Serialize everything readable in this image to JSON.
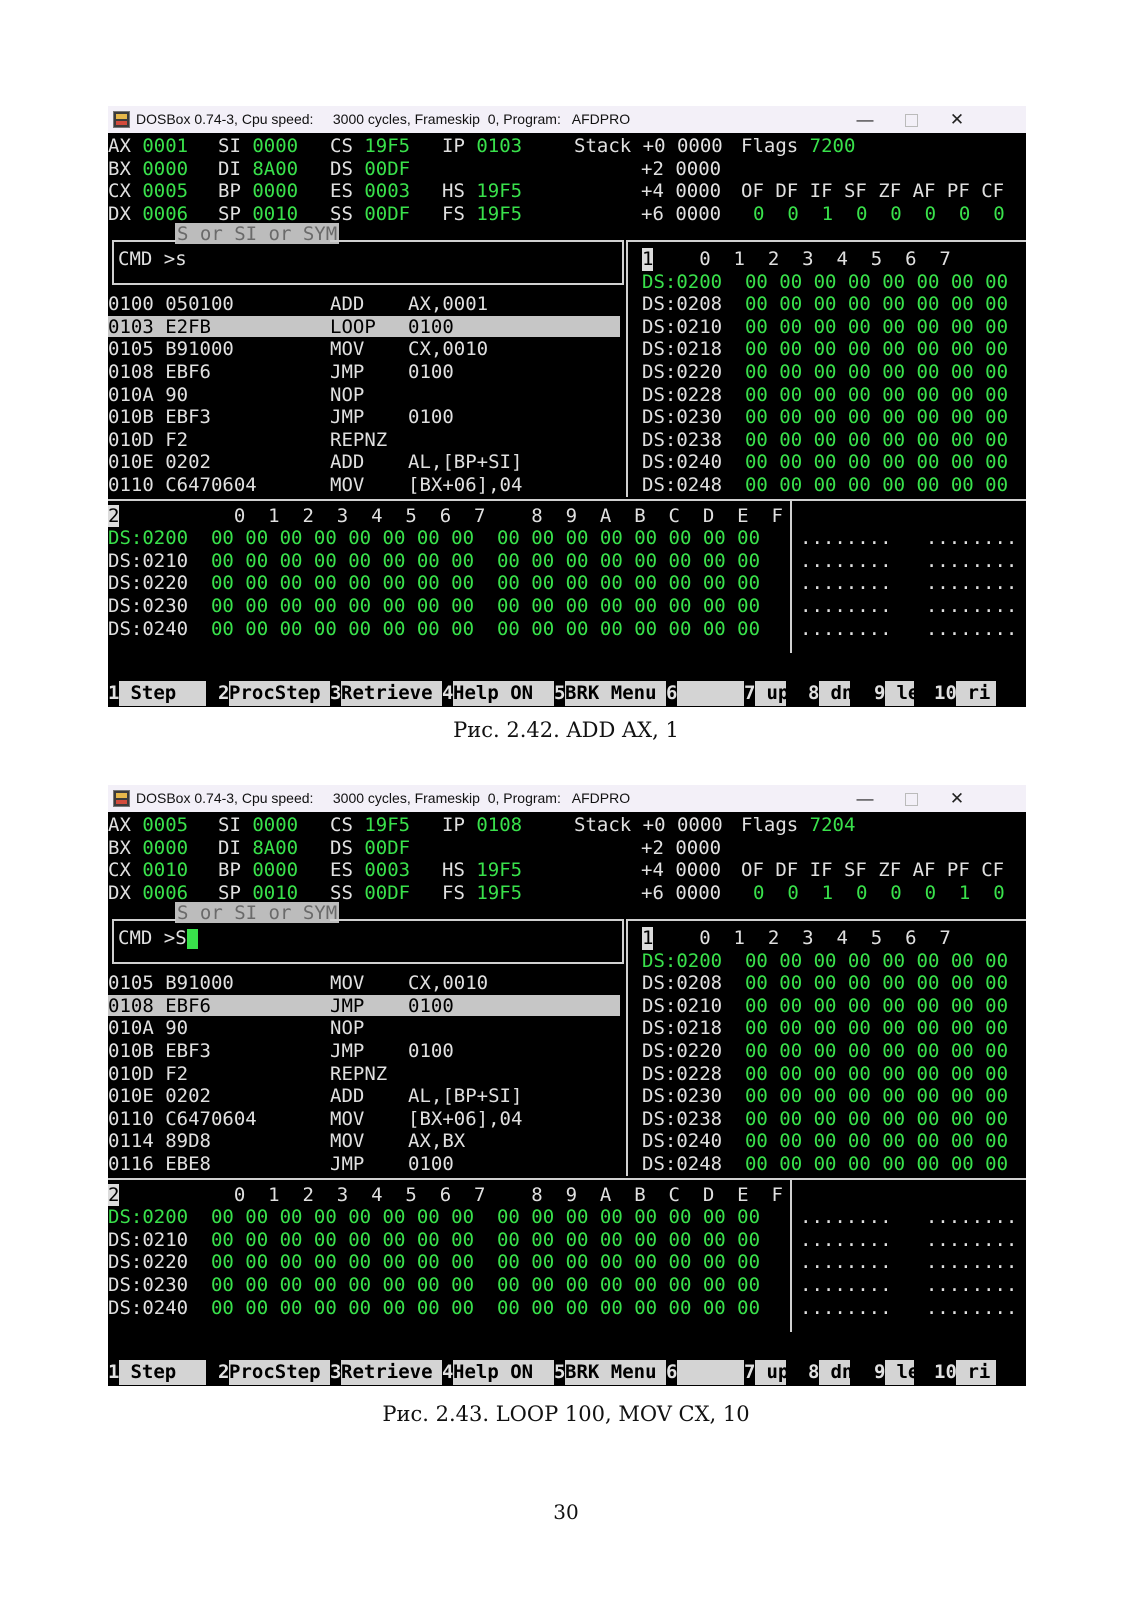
{
  "titlebar": {
    "text": "DOSBox 0.74-3, Cpu speed:     3000 cycles, Frameskip  0, Program:   AFDPRO",
    "minimize": "—",
    "close": "✕"
  },
  "screenshots": [
    {
      "registers": {
        "row1": [
          "AX",
          "0001",
          "SI",
          "0000",
          "CS",
          "19F5",
          "IP",
          "0103"
        ],
        "row2": [
          "BX",
          "0000",
          "DI",
          "8A00",
          "DS",
          "00DF"
        ],
        "row3": [
          "CX",
          "0005",
          "BP",
          "0000",
          "ES",
          "0003",
          "HS",
          "19F5"
        ],
        "row4": [
          "DX",
          "0006",
          "SP",
          "0010",
          "SS",
          "00DF",
          "FS",
          "19F5"
        ]
      },
      "stack": [
        [
          "Stack +0",
          "0000"
        ],
        [
          "+2",
          "0000"
        ],
        [
          "+4",
          "0000"
        ],
        [
          "+6",
          "0000"
        ]
      ],
      "flags_label": "Flags",
      "flags_value": "7200",
      "flag_names": "OF DF IF SF ZF AF PF CF",
      "flag_values": "0  0  1  0  0  0  0  0",
      "sym_tab": "S or SI or SYM",
      "cmd_prompt": "CMD >",
      "cmd_text": "s",
      "disasm": [
        [
          "0100 050100",
          "ADD",
          "AX,0001"
        ],
        [
          "0103 E2FB",
          "LOOP",
          "0100"
        ],
        [
          "0105 B91000",
          "MOV",
          "CX,0010"
        ],
        [
          "0108 EBF6",
          "JMP",
          "0100"
        ],
        [
          "010A 90",
          "NOP",
          ""
        ],
        [
          "010B EBF3",
          "JMP",
          "0100"
        ],
        [
          "010D F2",
          "REPNZ",
          ""
        ],
        [
          "010E 0202",
          "ADD",
          "AL,[BP+SI]"
        ],
        [
          "0110 C6470604",
          "MOV",
          "[BX+06],04"
        ]
      ],
      "highlight_row": 1,
      "mem1_label": "1",
      "mem1_header": "0  1  2  3  4  5  6  7",
      "mem1_rows": [
        "DS:0200",
        "DS:0208",
        "DS:0210",
        "DS:0218",
        "DS:0220",
        "DS:0228",
        "DS:0230",
        "DS:0238",
        "DS:0240",
        "DS:0248"
      ],
      "mem2_label": "2",
      "mem2_header": "0  1  2  3  4  5  6  7    8  9  A  B  C  D  E  F",
      "mem2_rows": [
        "DS:0200",
        "DS:0210",
        "DS:0220",
        "DS:0230",
        "DS:0240"
      ],
      "byte_row8": "00 00 00 00 00 00 00 00",
      "ascii": "........   ........",
      "fkeys": [
        [
          "1",
          " Step "
        ],
        [
          "2",
          "ProcStep"
        ],
        [
          "3",
          "Retrieve"
        ],
        [
          "4",
          "Help ON "
        ],
        [
          "5",
          "BRK Menu"
        ],
        [
          "6",
          "      "
        ],
        [
          "7",
          " up"
        ],
        [
          "8",
          " dn"
        ],
        [
          "9",
          " le"
        ],
        [
          "10",
          " ri"
        ]
      ],
      "caption": "Рис. 2.42. ADD AX, 1"
    },
    {
      "registers": {
        "row1": [
          "AX",
          "0005",
          "SI",
          "0000",
          "CS",
          "19F5",
          "IP",
          "0108"
        ],
        "row2": [
          "BX",
          "0000",
          "DI",
          "8A00",
          "DS",
          "00DF"
        ],
        "row3": [
          "CX",
          "0010",
          "BP",
          "0000",
          "ES",
          "0003",
          "HS",
          "19F5"
        ],
        "row4": [
          "DX",
          "0006",
          "SP",
          "0010",
          "SS",
          "00DF",
          "FS",
          "19F5"
        ]
      },
      "stack": [
        [
          "Stack +0",
          "0000"
        ],
        [
          "+2",
          "0000"
        ],
        [
          "+4",
          "0000"
        ],
        [
          "+6",
          "0000"
        ]
      ],
      "flags_label": "Flags",
      "flags_value": "7204",
      "flag_names": "OF DF IF SF ZF AF PF CF",
      "flag_values": "0  0  1  0  0  0  1  0",
      "sym_tab": "S or SI or SYM",
      "cmd_prompt": "CMD >",
      "cmd_text": "S",
      "disasm": [
        [
          "0105 B91000",
          "MOV",
          "CX,0010"
        ],
        [
          "0108 EBF6",
          "JMP",
          "0100"
        ],
        [
          "010A 90",
          "NOP",
          ""
        ],
        [
          "010B EBF3",
          "JMP",
          "0100"
        ],
        [
          "010D F2",
          "REPNZ",
          ""
        ],
        [
          "010E 0202",
          "ADD",
          "AL,[BP+SI]"
        ],
        [
          "0110 C6470604",
          "MOV",
          "[BX+06],04"
        ],
        [
          "0114 89D8",
          "MOV",
          "AX,BX"
        ],
        [
          "0116 EBE8",
          "JMP",
          "0100"
        ]
      ],
      "highlight_row": 1,
      "mem1_label": "1",
      "mem1_header": "0  1  2  3  4  5  6  7",
      "mem1_rows": [
        "DS:0200",
        "DS:0208",
        "DS:0210",
        "DS:0218",
        "DS:0220",
        "DS:0228",
        "DS:0230",
        "DS:0238",
        "DS:0240",
        "DS:0248"
      ],
      "mem2_label": "2",
      "mem2_header": "0  1  2  3  4  5  6  7    8  9  A  B  C  D  E  F",
      "mem2_rows": [
        "DS:0200",
        "DS:0210",
        "DS:0220",
        "DS:0230",
        "DS:0240"
      ],
      "byte_row8": "00 00 00 00 00 00 00 00",
      "ascii": "........   ........",
      "fkeys": [
        [
          "1",
          " Step "
        ],
        [
          "2",
          "ProcStep"
        ],
        [
          "3",
          "Retrieve"
        ],
        [
          "4",
          "Help ON "
        ],
        [
          "5",
          "BRK Menu"
        ],
        [
          "6",
          "      "
        ],
        [
          "7",
          " up"
        ],
        [
          "8",
          " dn"
        ],
        [
          "9",
          " le"
        ],
        [
          "10",
          " ri"
        ]
      ],
      "caption": "Рис. 2.43. LOOP 100, MOV CX, 10"
    }
  ],
  "page_number": "30"
}
